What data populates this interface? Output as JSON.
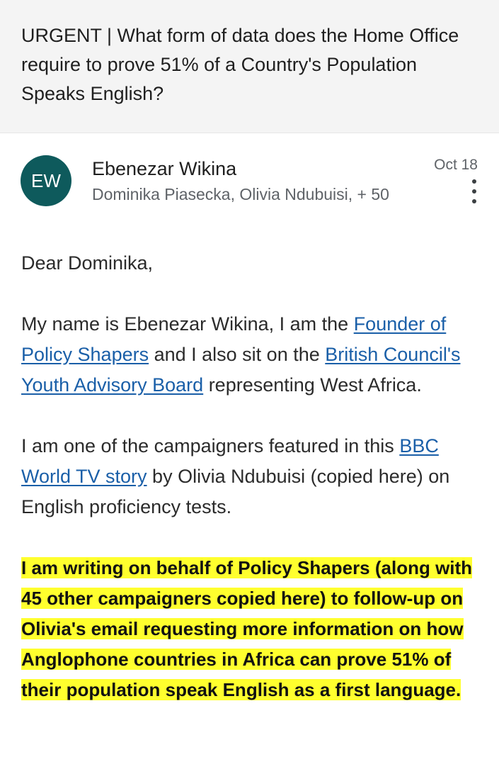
{
  "email": {
    "subject": "URGENT | What form of data does the Home Office require to prove 51% of a Country's Population Speaks English?",
    "sender": {
      "initials": "EW",
      "name": "Ebenezar Wikina",
      "recipients": "Dominika Piasecka, Olivia Ndubuisi, + 50",
      "date": "Oct 18",
      "avatar_color": "#0e5a5c"
    },
    "more_menu_icon": "vertical-dots-icon",
    "body": {
      "greeting": "Dear Dominika,",
      "p1_text1": "My name is Ebenezar Wikina, I am the ",
      "p1_link1": "Founder of Policy Shapers",
      "p1_text2": " and I also sit on the ",
      "p1_link2": "British Council's Youth Advisory Board",
      "p1_text3": " representing West Africa.",
      "p2_text1": "I am one of the campaigners featured in this ",
      "p2_link1": "BBC World TV story",
      "p2_text2": " by Olivia Ndubuisi (copied here) on English proficiency tests.",
      "p3_highlight": "I am writing on behalf of Policy Shapers (along with 45 other campaigners copied here) to follow-up on Olivia's email requesting more information on how Anglophone countries in Africa can prove 51% of their population speak English as a first language."
    }
  },
  "colors": {
    "link": "#1a5fa8",
    "highlight": "#ffff2e",
    "subject_background": "#f4f4f4"
  }
}
